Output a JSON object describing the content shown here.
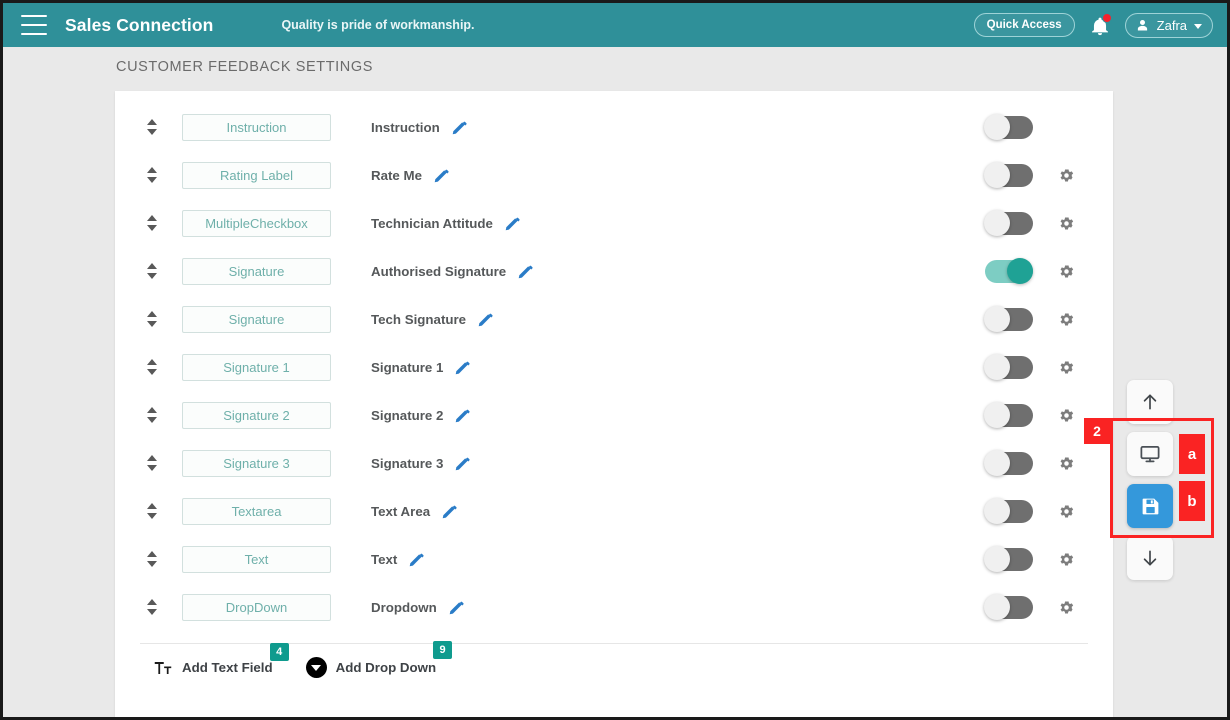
{
  "topbar": {
    "menu_icon": "hamburger-icon",
    "brand": "Sales Connection",
    "tagline": "Quality is pride of workmanship.",
    "quick_access_label": "Quick Access",
    "notification_icon": "bell-icon",
    "user_name": "Zafra",
    "user_icon": "person-icon",
    "chevron_icon": "chevron-down-icon",
    "accent_color": "#2f9099"
  },
  "page": {
    "title": "CUSTOMER FEEDBACK SETTINGS",
    "background_color": "#e9e9e9",
    "card_color": "#ffffff"
  },
  "rows": [
    {
      "type": "Instruction",
      "label": "Instruction",
      "enabled": false,
      "has_gear": false
    },
    {
      "type": "Rating Label",
      "label": "Rate Me",
      "enabled": false,
      "has_gear": true
    },
    {
      "type": "MultipleCheckbox",
      "label": "Technician Attitude",
      "enabled": false,
      "has_gear": true
    },
    {
      "type": "Signature",
      "label": "Authorised Signature",
      "enabled": true,
      "has_gear": true
    },
    {
      "type": "Signature",
      "label": "Tech Signature",
      "enabled": false,
      "has_gear": true
    },
    {
      "type": "Signature 1",
      "label": "Signature 1",
      "enabled": false,
      "has_gear": true
    },
    {
      "type": "Signature 2",
      "label": "Signature 2",
      "enabled": false,
      "has_gear": true
    },
    {
      "type": "Signature 3",
      "label": "Signature 3",
      "enabled": false,
      "has_gear": true
    },
    {
      "type": "Textarea",
      "label": "Text Area",
      "enabled": false,
      "has_gear": true
    },
    {
      "type": "Text",
      "label": "Text",
      "enabled": false,
      "has_gear": true
    },
    {
      "type": "DropDown",
      "label": "Dropdown",
      "enabled": false,
      "has_gear": true
    }
  ],
  "row_icons": {
    "drag_icon": "sort-updown-icon",
    "edit_icon": "pencil-icon",
    "settings_icon": "gear-icon",
    "toggle_icon": "toggle-switch",
    "toggle_on_color": "#1fa295",
    "toggle_off_color": "#6f6f6f",
    "edit_icon_color": "#2a7cc7",
    "type_text_color": "#6fb0aa"
  },
  "add_buttons": [
    {
      "icon": "text-format-icon",
      "label": "Add Text Field",
      "count": "4"
    },
    {
      "icon": "dropdown-circle-icon",
      "label": "Add Drop Down",
      "count": "9"
    }
  ],
  "side_toolbar": {
    "scroll_up": {
      "icon": "arrow-up-icon"
    },
    "preview": {
      "icon": "monitor-icon"
    },
    "save": {
      "icon": "save-floppy-icon",
      "color": "#3498db"
    },
    "scroll_down": {
      "icon": "arrow-down-icon"
    }
  },
  "annotations": {
    "box_number": "2",
    "badge_a": "a",
    "badge_b": "b",
    "color": "#fa2323"
  }
}
